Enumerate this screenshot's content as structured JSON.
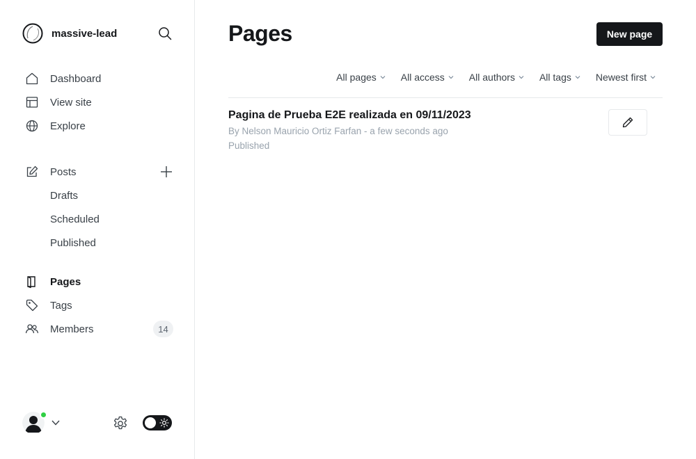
{
  "site": {
    "name": "massive-lead"
  },
  "nav": {
    "dashboard": "Dashboard",
    "view_site": "View site",
    "explore": "Explore",
    "posts": "Posts",
    "drafts": "Drafts",
    "scheduled": "Scheduled",
    "published": "Published",
    "pages": "Pages",
    "tags": "Tags",
    "members": "Members",
    "members_count": "14"
  },
  "header": {
    "title": "Pages",
    "new_button": "New page"
  },
  "filters": {
    "type": "All pages",
    "access": "All access",
    "authors": "All authors",
    "tags": "All tags",
    "sort": "Newest first"
  },
  "pages_list": [
    {
      "title": "Pagina de Prueba E2E realizada en 09/11/2023",
      "meta": "By Nelson Mauricio Ortiz Farfan - a few seconds ago",
      "status": "Published"
    }
  ],
  "icons": {
    "logo": "ghost-logo-icon",
    "search": "search-icon",
    "dashboard": "home-icon",
    "view_site": "layout-icon",
    "explore": "globe-icon",
    "posts": "edit-icon",
    "add": "plus-icon",
    "pages": "page-icon",
    "tags": "tag-icon",
    "members": "members-icon",
    "settings": "gear-icon",
    "theme": "sun-icon",
    "edit": "pencil-icon"
  },
  "colors": {
    "primary_text": "#15171a",
    "muted_text": "#99a3ad",
    "online": "#30cf43",
    "button_dark": "#15171a"
  }
}
